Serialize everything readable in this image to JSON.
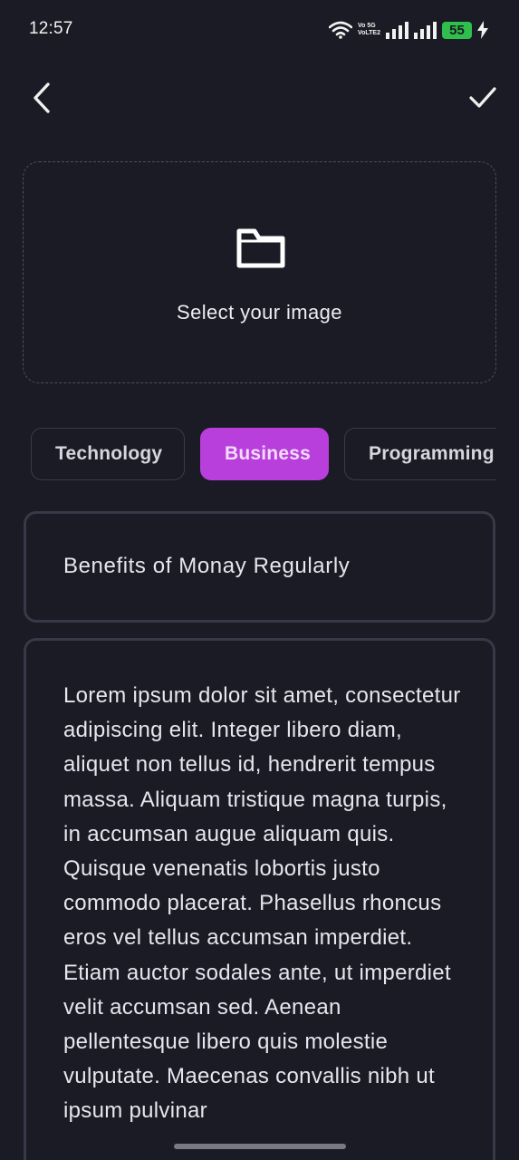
{
  "status_bar": {
    "time": "12:57",
    "volte_top": "Vo 5G",
    "volte_bottom": "VoLTE2",
    "battery": "55",
    "icons": [
      "wifi-icon",
      "signal-icon",
      "signal-icon",
      "battery-icon",
      "charging-icon"
    ]
  },
  "toolbar": {
    "back_icon": "chevron-left-icon",
    "confirm_icon": "checkmark-icon"
  },
  "image_picker": {
    "icon": "folder-icon",
    "label": "Select your image"
  },
  "categories": {
    "items": [
      "Technology",
      "Business",
      "Programming"
    ],
    "selected": "Business"
  },
  "form": {
    "title_value": "Benefits of Monay Regularly",
    "body_value": "Lorem ipsum dolor sit amet, consectetur adipiscing elit. Integer libero diam, aliquet non tellus id, hendrerit tempus massa. Aliquam tristique magna turpis, in accumsan augue aliquam quis. Quisque venenatis lobortis justo commodo placerat. Phasellus rhoncus eros vel tellus accumsan imperdiet. Etiam auctor sodales ante, ut imperdiet velit accumsan sed. Aenean pellentesque libero quis molestie vulputate. Maecenas convallis nibh ut ipsum pulvinar"
  },
  "colors": {
    "background": "#1b1b25",
    "accent": "#b93fdc",
    "border": "#383848"
  }
}
